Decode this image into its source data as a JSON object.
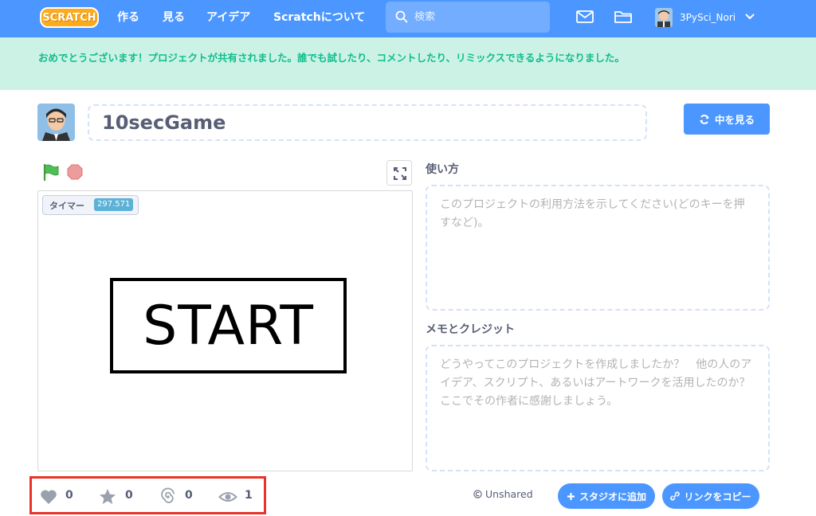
{
  "nav": {
    "logo_text": "SCRATCH",
    "create": "作る",
    "explore": "見る",
    "ideas": "アイデア",
    "about": "Scratchについて",
    "search_placeholder": "検索",
    "username": "3PySci_Nori"
  },
  "banner": {
    "message": "おめでとうございます！プロジェクトが共有されました。誰でも試したり、コメントしたり、リミックスできるようになりました。"
  },
  "project": {
    "title": "10secGame",
    "see_inside": "中を見る"
  },
  "stage": {
    "monitor_label": "タイマー",
    "monitor_value": "297.571",
    "start_text": "START"
  },
  "instructions": {
    "label": "使い方",
    "placeholder": "このプロジェクトの利用方法を示してください(どのキーを押すなど)。"
  },
  "notes": {
    "label": "メモとクレジット",
    "placeholder": "どうやってこのプロジェクトを作成しましたか？　他の人のアイデア、スクリプト、あるいはアートワークを活用したのか？　ここでその作者に感謝しましょう。"
  },
  "stats": {
    "loves": "0",
    "favorites": "0",
    "remixes": "0",
    "views": "1"
  },
  "sharing": {
    "status": "Unshared",
    "add_to_studio": "スタジオに追加",
    "copy_link": "リンクをコピー"
  },
  "colors": {
    "nav_blue": "#4c97ff",
    "banner_bg": "#ccf2e5",
    "banner_text": "#0fbd8c",
    "highlight_red": "#e8322a",
    "logo_orange": "#ffab19"
  }
}
